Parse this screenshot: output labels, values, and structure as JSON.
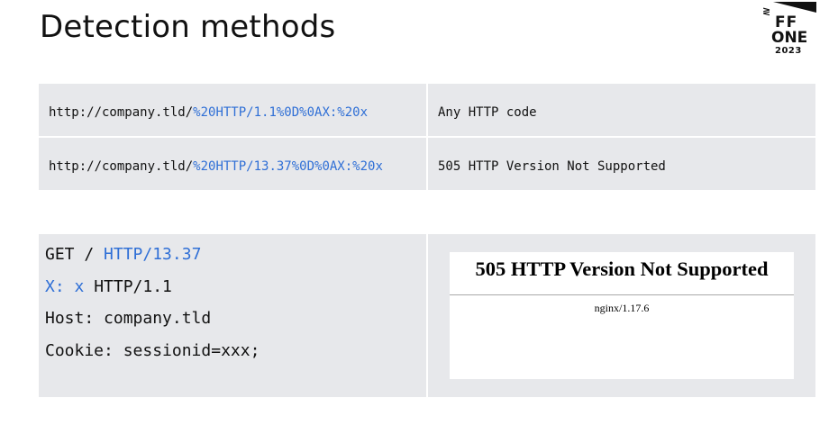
{
  "slide": {
    "title": "Detection methods"
  },
  "logo": {
    "line1": "FF",
    "line2": "ONE",
    "line3": "2023",
    "mark": "≷"
  },
  "url_table": [
    {
      "url_base": "http://company.tld/",
      "url_payload": "%20HTTP/1.1%0D%0AX:%20x",
      "response": "Any HTTP code"
    },
    {
      "url_base": "http://company.tld/",
      "url_payload": "%20HTTP/13.37%0D%0AX:%20x",
      "response": "505 HTTP Version Not Supported"
    }
  ],
  "request": {
    "line1_plain": "GET / ",
    "line1_hl": "HTTP/13.37",
    "line2_hl": "X: x",
    "line2_plain": " HTTP/1.1",
    "line3": "Host: company.tld",
    "line4": "Cookie: sessionid=xxx;"
  },
  "error_page": {
    "heading": "505 HTTP Version Not Supported",
    "server": "nginx/1.17.6"
  },
  "colors": {
    "highlight": "#2f6fd6",
    "cell_background": "#e7e8eb"
  }
}
